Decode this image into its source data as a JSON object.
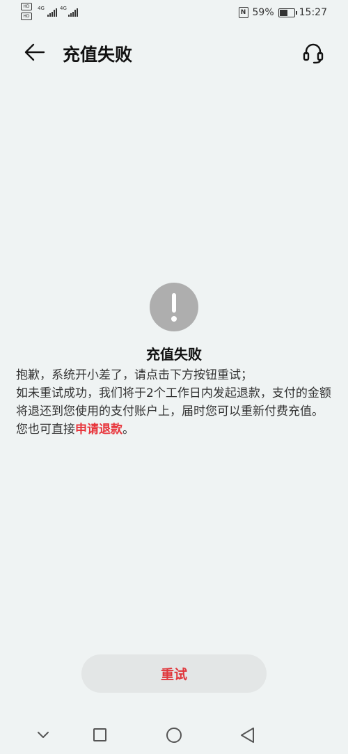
{
  "status_bar": {
    "hd_label": "HD",
    "network_1": "4G",
    "network_2": "4G",
    "battery_percent": "59%",
    "battery_level": 0.59,
    "time": "15:27",
    "nfc_label": "N"
  },
  "header": {
    "title": "充值失败",
    "back_icon": "arrow-left-icon",
    "service_icon": "headset-icon"
  },
  "result": {
    "icon": "exclamation-icon",
    "title": "充值失败",
    "line1": "抱歉，系统开小差了，请点击下方按钮重试；",
    "line2": "如未重试成功，我们将于2个工作日内发起退款，支付的金额将退还到您使用的支付账户上，届时您可以重新付费充值。",
    "line3_prefix": "您也可直接",
    "refund_link": "申请退款",
    "line3_suffix": "。",
    "accent_color": "#e8333a"
  },
  "retry_button": {
    "label": "重试"
  },
  "nav_bar": {
    "icons": [
      "chevron-down-icon",
      "square-icon",
      "circle-icon",
      "triangle-back-icon"
    ]
  }
}
